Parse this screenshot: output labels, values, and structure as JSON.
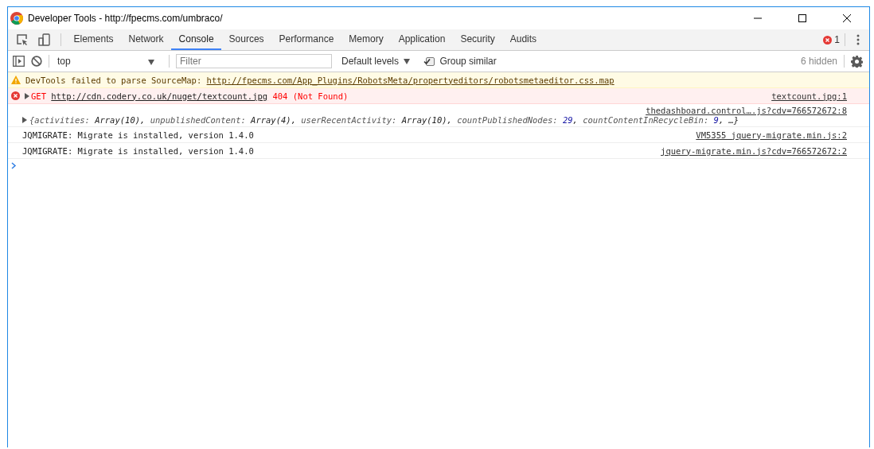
{
  "window": {
    "title": "Developer Tools - http://fpecms.com/umbraco/"
  },
  "tabs": [
    {
      "label": "Elements",
      "selected": false
    },
    {
      "label": "Network",
      "selected": false
    },
    {
      "label": "Console",
      "selected": true
    },
    {
      "label": "Sources",
      "selected": false
    },
    {
      "label": "Performance",
      "selected": false
    },
    {
      "label": "Memory",
      "selected": false
    },
    {
      "label": "Application",
      "selected": false
    },
    {
      "label": "Security",
      "selected": false
    },
    {
      "label": "Audits",
      "selected": false
    }
  ],
  "error_count": "1",
  "toolbar": {
    "context": "top",
    "filter": {
      "placeholder": "Filter"
    },
    "levels": "Default levels",
    "group_similar": {
      "label": "Group similar",
      "checked": true
    },
    "hidden": "6 hidden"
  },
  "messages": [
    {
      "kind": "warning",
      "prefix": "DevTools failed to parse SourceMap:",
      "url": "http://fpecms.com/App_Plugins/RobotsMeta/propertyeditors/robotsmetaeditor.css.map"
    },
    {
      "kind": "error",
      "prefix": "GET",
      "url": "http://cdn.codery.co.uk/nuget/textcount.jpg",
      "suffix": "404 (Not Found)",
      "source": "textcount.jpg:1"
    },
    {
      "kind": "object",
      "source": "thedashboard.control….js?cdv=766572672:8",
      "entries": [
        {
          "key": "{activities:",
          "value": "Array(10),",
          "kind": "other"
        },
        {
          "key": "unpublishedContent:",
          "value": "Array(4),",
          "kind": "other"
        },
        {
          "key": "userRecentActivity:",
          "value": "Array(10),",
          "kind": "other"
        },
        {
          "key": "countPublishedNodes:",
          "value": "29",
          "tail": ",",
          "kind": "number"
        },
        {
          "key": "countContentInRecycleBin:",
          "value": "9",
          "tail": ",",
          "kind": "number"
        },
        {
          "key": "…}",
          "kind": "more"
        }
      ]
    },
    {
      "kind": "log",
      "text": "JQMIGRATE: Migrate is installed, version 1.4.0",
      "source": "VM5355 jquery-migrate.min.js:2"
    },
    {
      "kind": "log",
      "text": "JQMIGRATE: Migrate is installed, version 1.4.0",
      "source": "jquery-migrate.min.js?cdv=766572672:2"
    }
  ]
}
